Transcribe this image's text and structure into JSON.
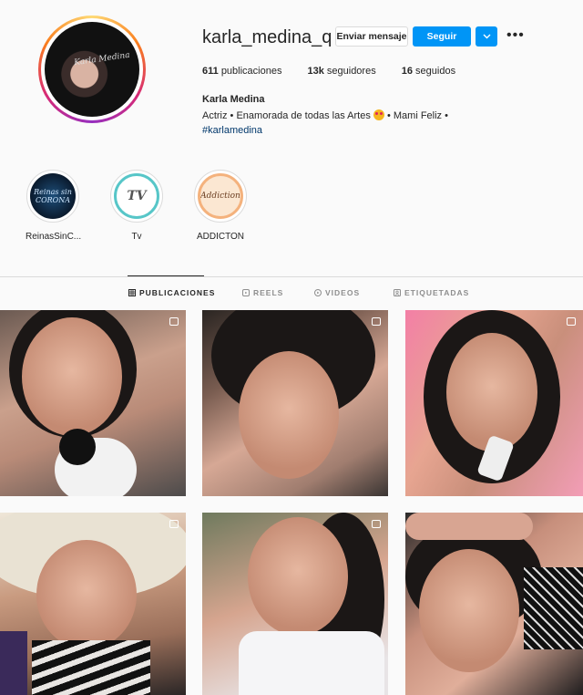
{
  "profile": {
    "username": "karla_medina_q",
    "avatar_signature": "Karla Medina",
    "actions": {
      "message": "Enviar mensaje",
      "follow": "Seguir",
      "dropdown_icon": "chevron-down-icon",
      "more_icon": "more-options-icon"
    },
    "stats": [
      {
        "count": "611",
        "label": "publicaciones"
      },
      {
        "count": "13k",
        "label": "seguidores"
      },
      {
        "count": "16",
        "label": "seguidos"
      }
    ],
    "bio": {
      "name": "Karla Medina",
      "line1_before": "Actriz • Enamorada de todas las Artes",
      "line1_after": "• Mami Feliz •",
      "hashtag": "#karlamedina"
    }
  },
  "highlights": [
    {
      "label": "ReinasSinC...",
      "cover_text": "Reinas sin CORONA"
    },
    {
      "label": "Tv",
      "cover_text": "TV"
    },
    {
      "label": "ADDICTON",
      "cover_text": "Addiction"
    }
  ],
  "tabs": [
    {
      "label": "PUBLICACIONES",
      "icon": "grid-icon",
      "active": true
    },
    {
      "label": "REELS",
      "icon": "reels-icon",
      "active": false
    },
    {
      "label": "VIDEOS",
      "icon": "video-icon",
      "active": false
    },
    {
      "label": "ETIQUETADAS",
      "icon": "tagged-icon",
      "active": false
    }
  ],
  "colors": {
    "accent": "#0095f6",
    "hashtag": "#00376b",
    "border": "#dbdbdb"
  }
}
